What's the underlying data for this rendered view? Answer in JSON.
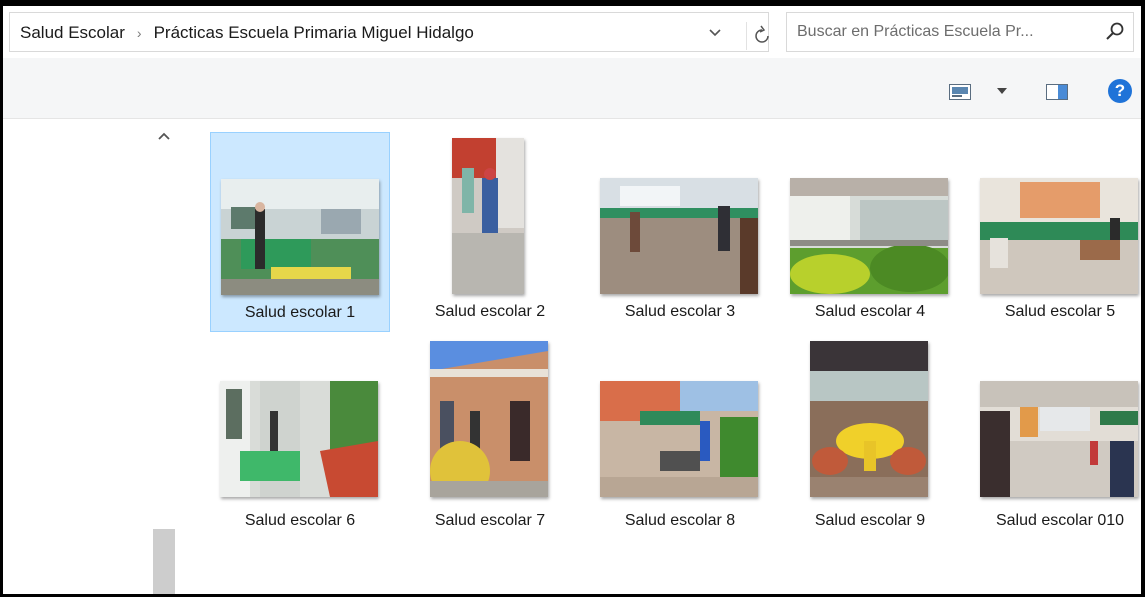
{
  "breadcrumb": {
    "root": "Salud Escolar",
    "separator": "›",
    "current": "Prácticas Escuela Primaria Miguel Hidalgo"
  },
  "search": {
    "placeholder": "Buscar en Prácticas Escuela Pr..."
  },
  "toolbar": {
    "help_label": "?"
  },
  "icons": {
    "history_dropdown": "chevron-down-icon",
    "refresh": "refresh-icon",
    "search": "search-icon",
    "view": "view-options-icon",
    "preview_pane": "preview-pane-icon",
    "help": "help-icon",
    "scroll_up": "scroll-up-icon"
  },
  "colors": {
    "selection": "#cce8ff",
    "selection_border": "#99d1ff",
    "help": "#1f73d8"
  },
  "files": [
    {
      "name": "Salud escolar 1",
      "selected": true
    },
    {
      "name": "Salud escolar 2",
      "selected": false
    },
    {
      "name": "Salud escolar 3",
      "selected": false
    },
    {
      "name": "Salud escolar 4",
      "selected": false
    },
    {
      "name": "Salud escolar 5",
      "selected": false
    },
    {
      "name": "Salud escolar 6",
      "selected": false
    },
    {
      "name": "Salud escolar 7",
      "selected": false
    },
    {
      "name": "Salud escolar 8",
      "selected": false
    },
    {
      "name": "Salud escolar 9",
      "selected": false
    },
    {
      "name": "Salud escolar 010",
      "selected": false
    }
  ]
}
